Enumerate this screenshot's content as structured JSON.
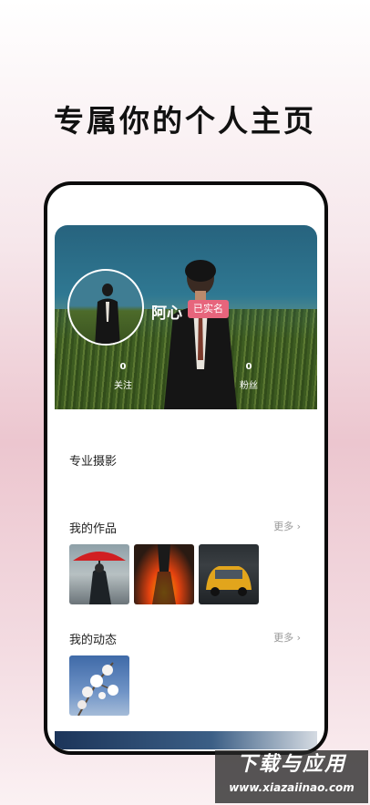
{
  "headline": "专属你的个人主页",
  "profile": {
    "name": "阿心",
    "verified_badge": "已实名",
    "stats": [
      {
        "value": "0",
        "label": "关注"
      },
      {
        "value": "0",
        "label": "粉丝"
      }
    ],
    "bio": "专业摄影"
  },
  "sections": {
    "works": {
      "title": "我的作品",
      "more": "更多 ›"
    },
    "moments": {
      "title": "我的动态",
      "more": "更多 ›"
    }
  },
  "watermark": {
    "line1": "下载与应用",
    "line2": "www.xiazaiinao.com"
  },
  "colors": {
    "badge": "#e7657c",
    "frame": "#0b0b0b"
  }
}
